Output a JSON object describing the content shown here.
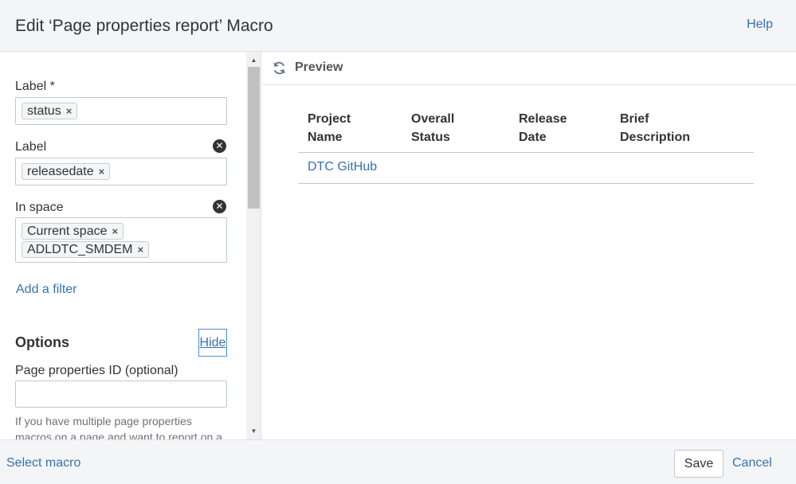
{
  "header": {
    "title": "Edit ‘Page properties report’ Macro",
    "help": "Help"
  },
  "filters": [
    {
      "label": "Label *",
      "tags": [
        "status"
      ],
      "clearable": false
    },
    {
      "label": "Label",
      "tags": [
        "releasedate"
      ],
      "clearable": true
    },
    {
      "label": "In space",
      "tags": [
        "Current space",
        "ADLDTC_SMDEM"
      ],
      "clearable": true
    }
  ],
  "tag_remove_glyph": "×",
  "clear_glyph": "✕",
  "add_filter": "Add a filter",
  "options": {
    "heading": "Options",
    "hide_label": "Hide",
    "ppid_label": "Page properties ID (optional)",
    "ppid_value": "",
    "help_text": "If you have multiple page properties macros on a page and want to report on a"
  },
  "preview": {
    "label": "Preview",
    "columns": [
      "Project\nName",
      "Overall\nStatus",
      "Release\nDate",
      "Brief\nDescription"
    ],
    "rows": [
      [
        "DTC GitHub",
        "",
        "",
        ""
      ]
    ]
  },
  "footer": {
    "select_macro": "Select macro",
    "save": "Save",
    "cancel": "Cancel"
  },
  "colors": {
    "link": "#3572b0",
    "header_bg": "#f4f5f7",
    "border": "#c1c7d0"
  }
}
